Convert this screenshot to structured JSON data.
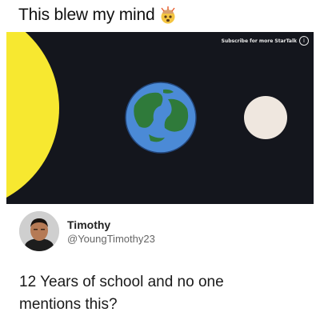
{
  "post": {
    "caption": "This blew my mind",
    "caption_emoji": "exploding-head-emoji"
  },
  "video": {
    "watermark": "Subscribe for more StarTalk",
    "colors": {
      "background": "#14161d",
      "sun": "#f7e830",
      "earth_ocean": "#4b8ad6",
      "earth_land": "#2f7a3a",
      "moon": "#efe7df"
    }
  },
  "tweet": {
    "display_name": "Timothy",
    "handle": "@YoungTimothy23",
    "text": "12 Years of school and no one mentions this?"
  }
}
